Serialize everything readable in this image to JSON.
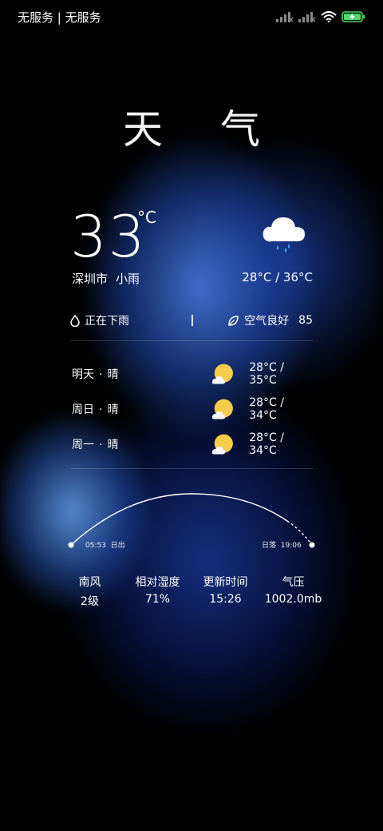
{
  "status_bar": {
    "carrier": "无服务 | 无服务",
    "icons": [
      "signal-icon",
      "signal-icon",
      "wifi-icon",
      "battery-charging-icon"
    ],
    "battery_color": "#4cd964"
  },
  "title": "天 气",
  "current": {
    "temperature": "33",
    "unit": "°C",
    "icon": "rain-cloud-icon",
    "city": "深圳市",
    "condition": "小雨",
    "range": "28°C / 36°C"
  },
  "info": {
    "precip_icon": "droplet-icon",
    "precip_text": "正在下雨",
    "aqi_icon": "leaf-icon",
    "aqi_text": "空气良好",
    "aqi_value": "85"
  },
  "forecast": [
    {
      "day": "明天",
      "sep": "·",
      "condition": "晴",
      "icon": "partly-sunny-icon",
      "range": "28°C / 35°C"
    },
    {
      "day": "周日",
      "sep": "·",
      "condition": "晴",
      "icon": "partly-sunny-icon",
      "range": "28°C / 34°C"
    },
    {
      "day": "周一",
      "sep": "·",
      "condition": "晴",
      "icon": "partly-sunny-icon",
      "range": "28°C / 34°C"
    }
  ],
  "sun": {
    "sunrise_time": "05:53",
    "sunrise_label": "日出",
    "sunset_label": "日落",
    "sunset_time": "19:06"
  },
  "stats": [
    {
      "label": "南风",
      "value": "2级"
    },
    {
      "label": "相对湿度",
      "value": "71%"
    },
    {
      "label": "更新时间",
      "value": "15:26"
    },
    {
      "label": "气压",
      "value": "1002.0mb"
    }
  ],
  "colors": {
    "sun": "#f7cc4a",
    "background_blue": "#2a5cc8"
  }
}
